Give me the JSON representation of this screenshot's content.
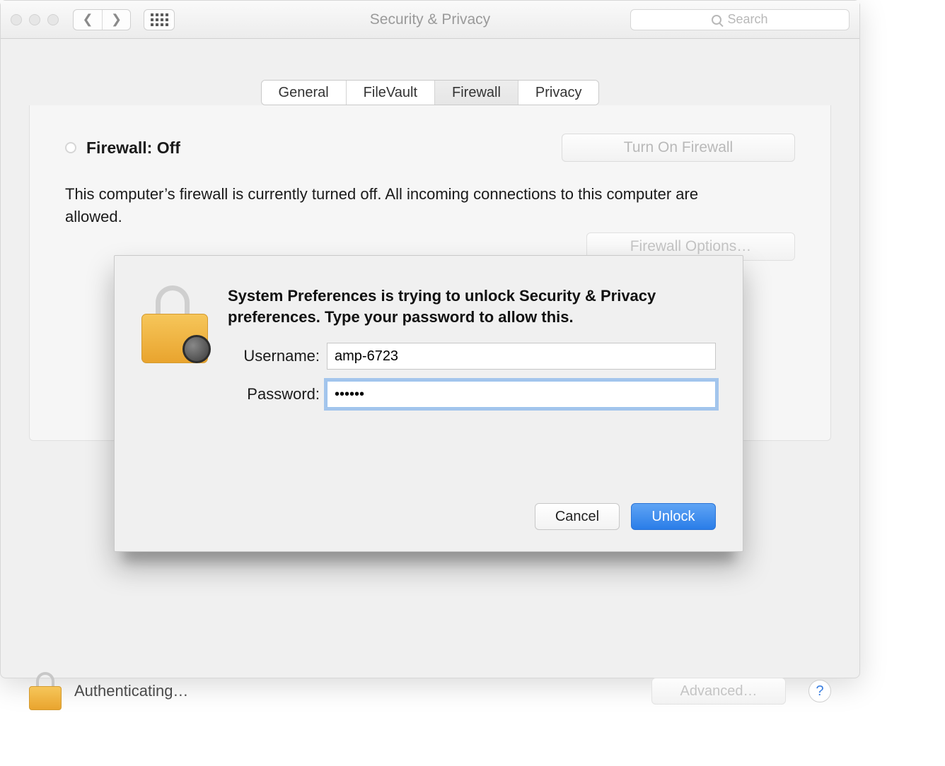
{
  "window_title": "Security & Privacy",
  "search_placeholder": "Search",
  "tabs": {
    "general": "General",
    "filevault": "FileVault",
    "firewall": "Firewall",
    "privacy": "Privacy",
    "selected_index": 2
  },
  "firewall": {
    "status_label": "Firewall: Off",
    "turn_on_label": "Turn On Firewall",
    "description": "This computer’s firewall is currently turned off. All incoming connections to this computer are allowed.",
    "options_label": "Firewall Options…"
  },
  "footer": {
    "auth_text": "Authenticating…",
    "advanced_label": "Advanced…"
  },
  "sheet": {
    "message": "System Preferences is trying to unlock Security & Privacy preferences. Type your password to allow this.",
    "username_label": "Username:",
    "password_label": "Password:",
    "username_value": "amp-6723",
    "password_value": "••••••",
    "cancel_label": "Cancel",
    "unlock_label": "Unlock"
  }
}
